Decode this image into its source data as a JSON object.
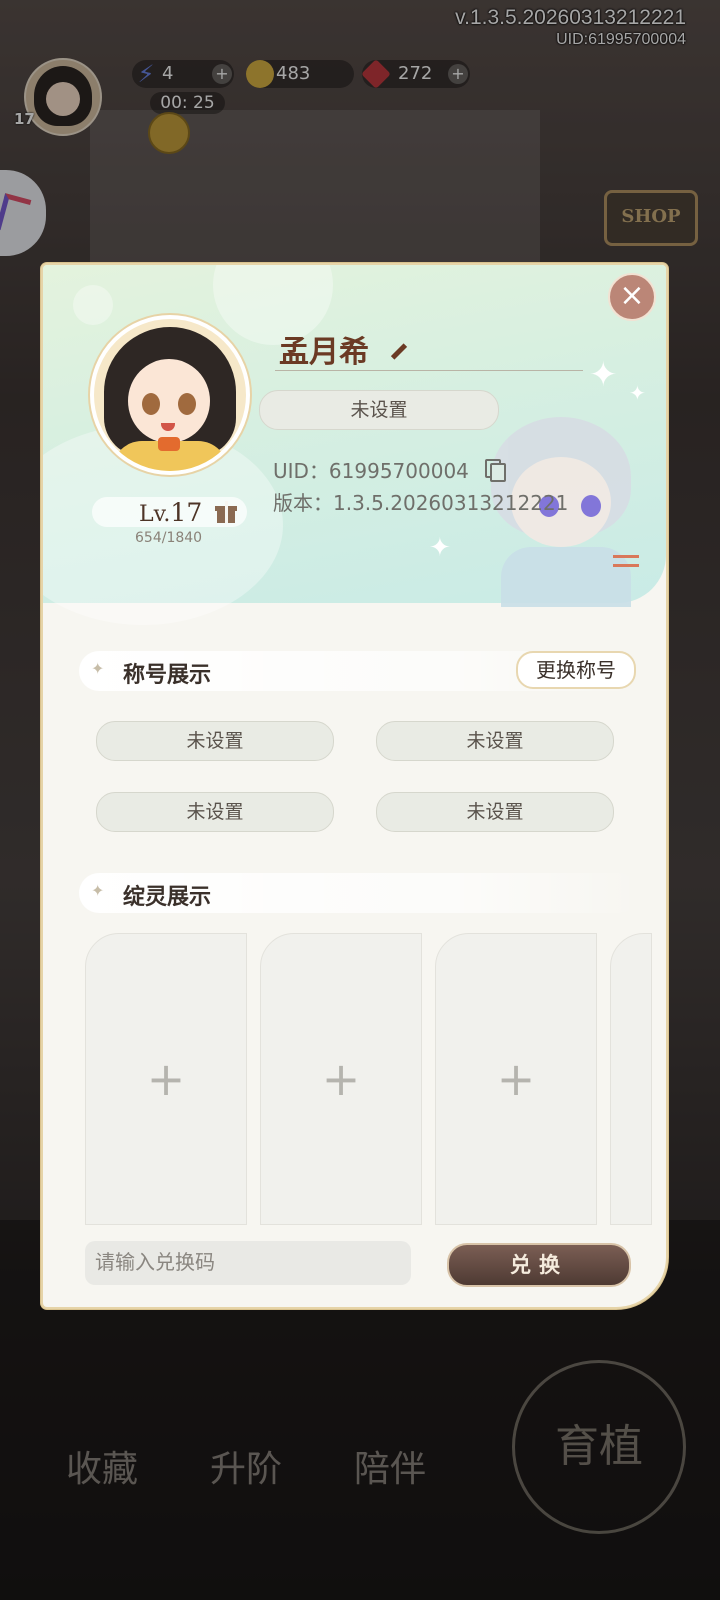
{
  "version": {
    "line1": "v.1.3.5.20260313212221",
    "line2": "UID:61995700004"
  },
  "hud": {
    "level": "17",
    "energy": "4",
    "coins": "483",
    "gems": "272",
    "timer": "00: 25",
    "plus": "+"
  },
  "shop_label": "SHOP",
  "bottom_nav": [
    "收藏",
    "升阶",
    "陪伴"
  ],
  "merge_label": "育植",
  "profile": {
    "name": "孟月希",
    "title_slot": "未设置",
    "uid_line": "UID：61995700004",
    "version_line": "版本：1.3.5.20260313212221",
    "level_prefix": "Lv.",
    "level": "17",
    "exp": "654/1840"
  },
  "close_label": "×",
  "titles_section": {
    "label": "称号展示",
    "change_button": "更换称号",
    "slots": [
      "未设置",
      "未设置",
      "未设置",
      "未设置"
    ]
  },
  "spirits_section": {
    "label": "绽灵展示",
    "card_plus": "+"
  },
  "redeem": {
    "placeholder": "请输入兑换码",
    "button": "兑换"
  },
  "colors": {
    "accent_brown": "#6b3a24",
    "panel_bg": "#f7f6f1",
    "close_bg": "#bb8677"
  }
}
